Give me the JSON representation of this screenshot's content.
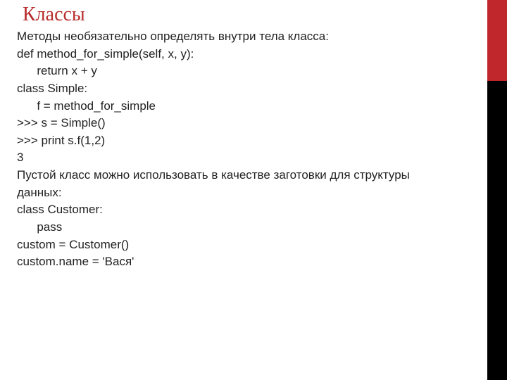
{
  "title": "Классы",
  "lines": [
    "Методы необязательно определять внутри тела класса:",
    "",
    "def method_for_simple(self, x, y):",
    "      return x + y",
    "class Simple:",
    "      f = method_for_simple",
    "",
    ">>> s = Simple()",
    ">>> print s.f(1,2)",
    "3",
    "",
    "Пустой класс можно использовать в качестве заготовки для структуры",
    "данных:",
    "",
    "class Customer:",
    "      pass",
    "custom = Customer()",
    "custom.name = 'Вася'"
  ],
  "accent": {
    "red": "#c0272d",
    "black": "#000000"
  }
}
